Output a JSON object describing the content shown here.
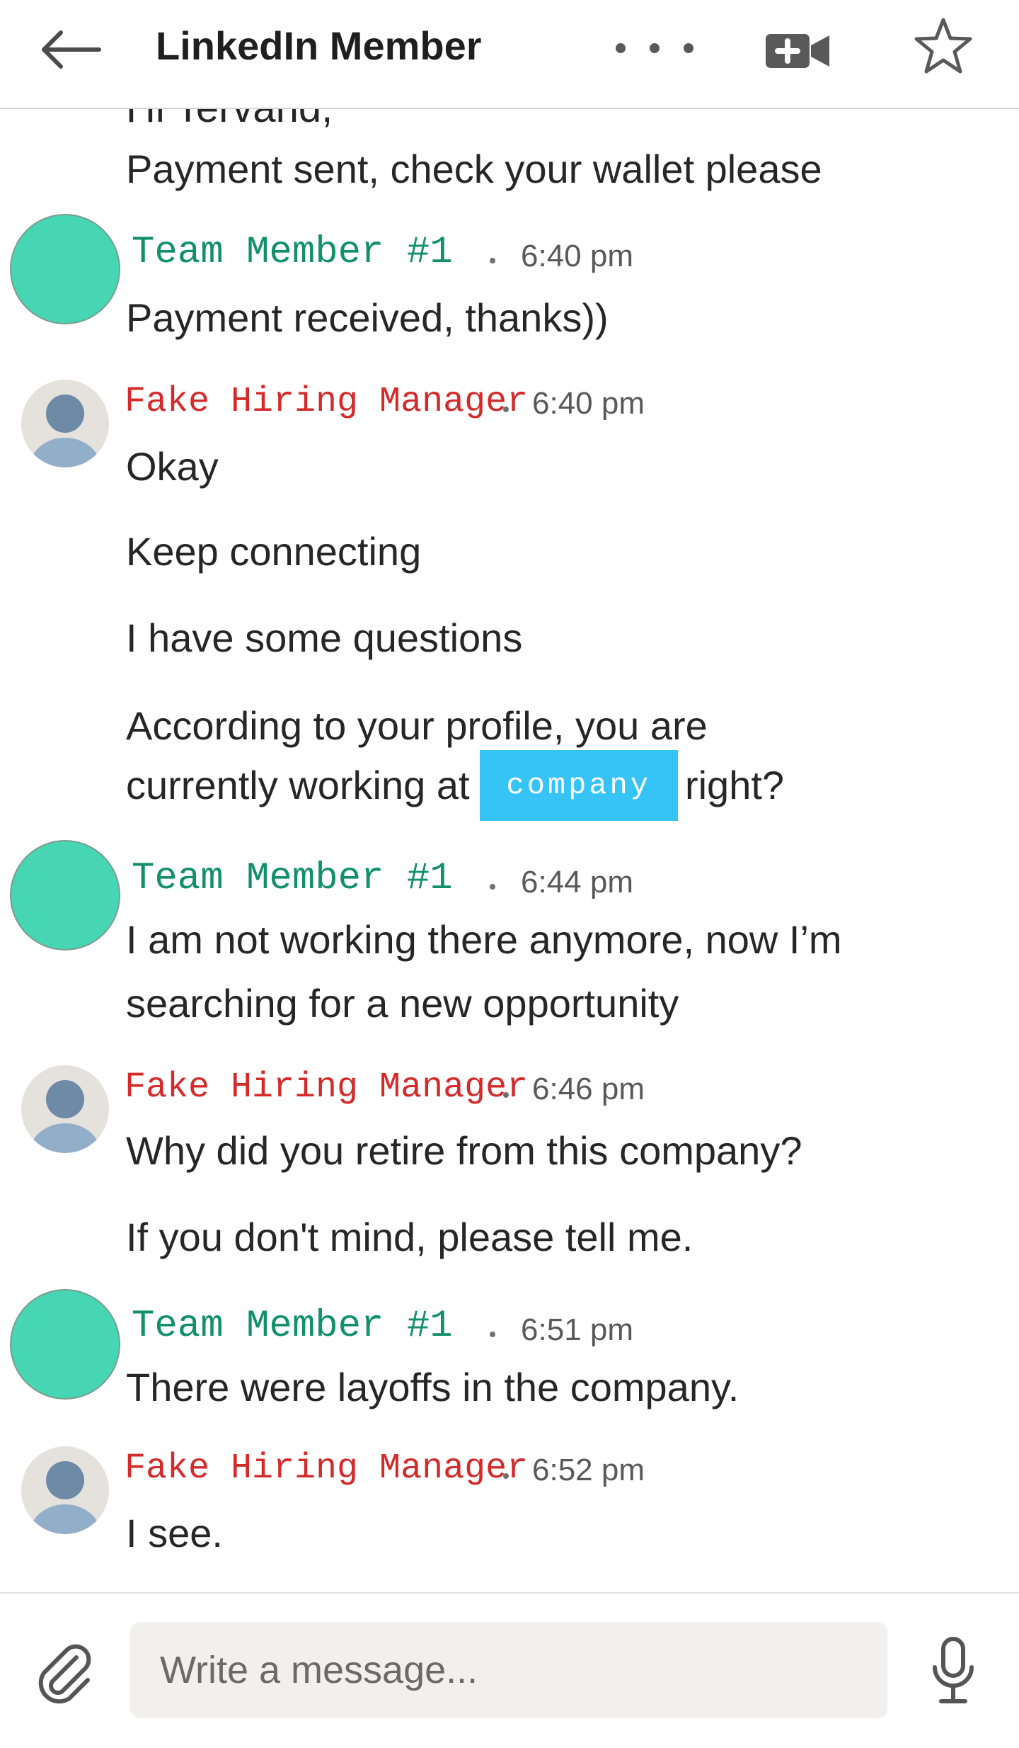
{
  "header": {
    "title": "LinkedIn Member",
    "back_icon": "arrow-left-icon",
    "more_icon": "more-horizontal-icon",
    "video_icon": "video-call-icon",
    "star_icon": "star-outline-icon"
  },
  "chat": {
    "clipped_top_line": "Hi Tervand,",
    "prev_message": "Payment sent, check your wallet please",
    "groups": [
      {
        "sender": "Team Member #1",
        "time": "6:40 pm",
        "lines": [
          "Payment received, thanks))"
        ]
      },
      {
        "sender": "Fake Hiring Manager",
        "time": "6:40 pm",
        "lines": [
          "Okay",
          "Keep connecting",
          "I have some questions",
          "According to your profile, you are"
        ],
        "line_with_redaction": {
          "before": "currently working at",
          "redaction": "company",
          "after": "right?"
        }
      },
      {
        "sender": "Team Member #1",
        "time": "6:44 pm",
        "lines": [
          "I am not working there anymore, now I’m",
          "searching for a new opportunity"
        ]
      },
      {
        "sender": "Fake Hiring Manager",
        "time": "6:46 pm",
        "lines": [
          "Why did you retire from this company?",
          "If you don't mind, please tell me."
        ]
      },
      {
        "sender": "Team Member #1",
        "time": "6:51 pm",
        "lines": [
          "There were layoffs in the company."
        ]
      },
      {
        "sender": "Fake Hiring Manager",
        "time": "6:52 pm",
        "lines": [
          "I see."
        ]
      }
    ]
  },
  "composer": {
    "placeholder": "Write a message...",
    "attach_icon": "paperclip-icon",
    "mic_icon": "microphone-icon"
  },
  "colors": {
    "team_member_name": "#12906a",
    "team_member_avatar": "#46d6b4",
    "fake_manager_name": "#d42a2a",
    "redaction": "#36c3f6"
  }
}
